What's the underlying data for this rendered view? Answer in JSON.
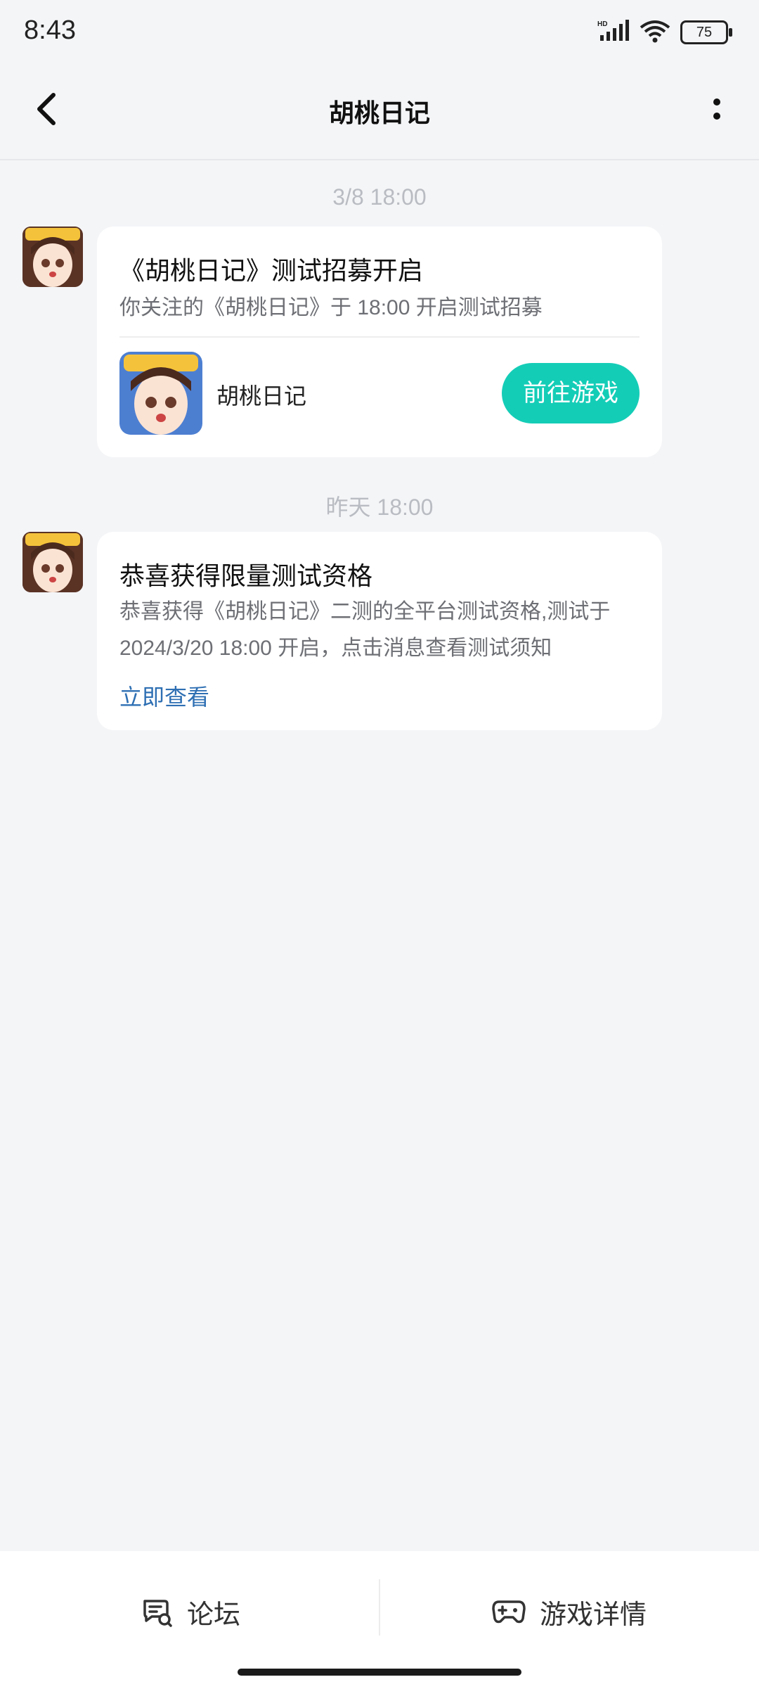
{
  "status": {
    "time": "8:43",
    "battery": "75",
    "network": "HD"
  },
  "header": {
    "title": "胡桃日记"
  },
  "messages": [
    {
      "timestamp": "3/8  18:00",
      "title": "《胡桃日记》测试招募开启",
      "desc": "你关注的《胡桃日记》于 18:00 开启测试招募",
      "game_name": "胡桃日记",
      "button": "前往游戏"
    },
    {
      "timestamp": "昨天  18:00",
      "title": "恭喜获得限量测试资格",
      "desc": "恭喜获得《胡桃日记》二测的全平台测试资格,测试于 2024/3/20 18:00 开启，点击消息查看测试须知",
      "link": "立即查看"
    }
  ],
  "bottom_tabs": [
    {
      "label": "论坛",
      "icon": "forum-icon"
    },
    {
      "label": "游戏详情",
      "icon": "gamepad-icon"
    }
  ],
  "colors": {
    "accent": "#14cdb7",
    "link": "#2e6fb3",
    "background": "#f4f5f7"
  }
}
